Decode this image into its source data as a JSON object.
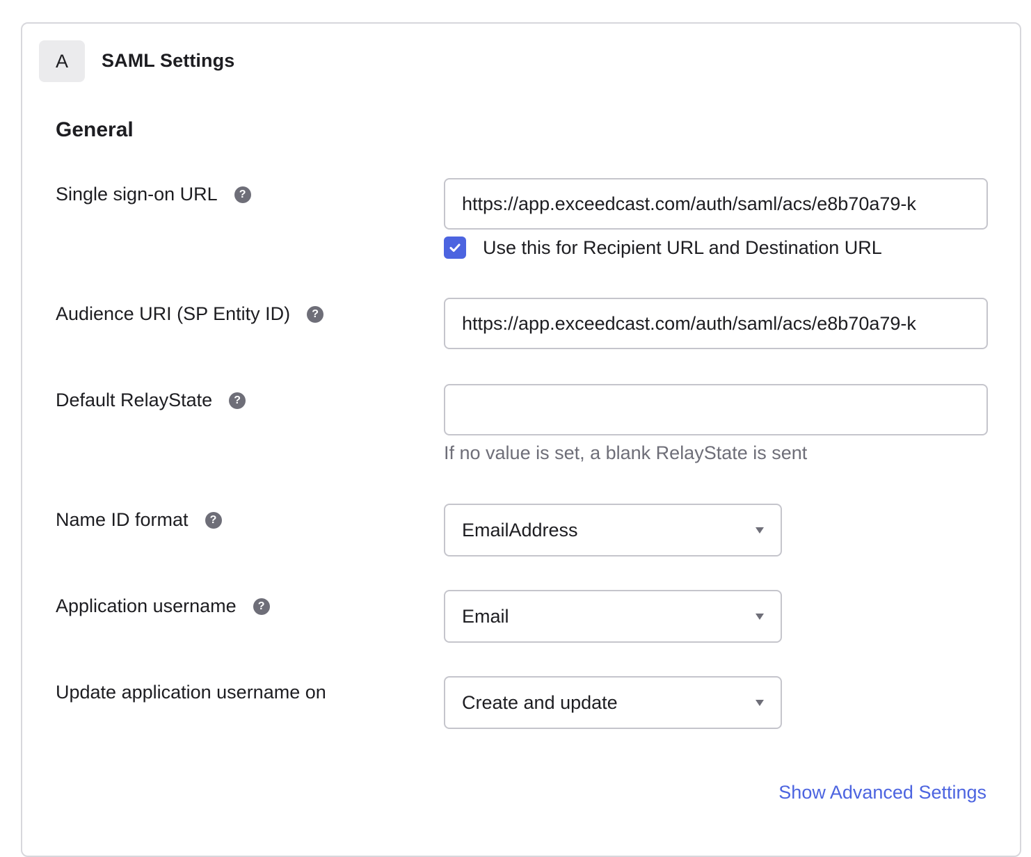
{
  "panel": {
    "step": "A",
    "title": "SAML Settings"
  },
  "section": {
    "title": "General"
  },
  "fields": {
    "sso_url": {
      "label": "Single sign-on URL",
      "value": "https://app.exceedcast.com/auth/saml/acs/e8b70a79-k",
      "checkbox_label": "Use this for Recipient URL and Destination URL",
      "checkbox_checked": true
    },
    "audience_uri": {
      "label": "Audience URI (SP Entity ID)",
      "value": "https://app.exceedcast.com/auth/saml/acs/e8b70a79-k"
    },
    "relay_state": {
      "label": "Default RelayState",
      "value": "",
      "hint": "If no value is set, a blank RelayState is sent"
    },
    "name_id_format": {
      "label": "Name ID format",
      "selected": "EmailAddress"
    },
    "app_username": {
      "label": "Application username",
      "selected": "Email"
    },
    "update_username_on": {
      "label": "Update application username on",
      "selected": "Create and update"
    }
  },
  "links": {
    "advanced": "Show Advanced Settings"
  },
  "icons": {
    "help": "?",
    "help_icon": "help-icon",
    "check_icon": "check-icon",
    "chevron_icon": "chevron-down-icon"
  },
  "colors": {
    "accent": "#4c64e0",
    "border": "#c5c5cc",
    "muted_text": "#6e6e78"
  }
}
